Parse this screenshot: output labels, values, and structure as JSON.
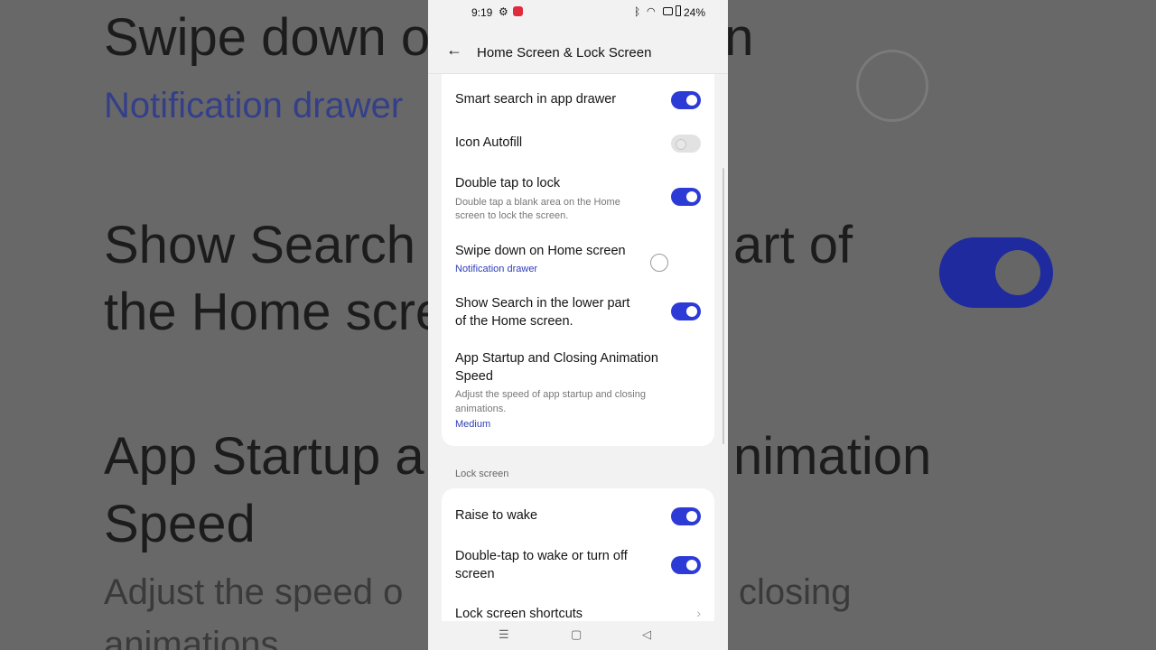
{
  "background": {
    "line1": "Swipe down o",
    "line1b": "en",
    "line2": "Notification drawer",
    "line3": "Show Search i",
    "line3b": "art of",
    "line4": "the Home scre",
    "line5": "App Startup a",
    "line5b": "nimation",
    "line6": "Speed",
    "line7": "Adjust the speed o",
    "line7b": "closing",
    "line8": "animations"
  },
  "status_bar": {
    "time": "9:19",
    "battery": "24%",
    "icons": [
      "gear-icon",
      "app-notification-icon",
      "bluetooth-icon",
      "wifi-icon",
      "sim-icon",
      "battery-icon"
    ]
  },
  "header": {
    "title": "Home Screen & Lock Screen",
    "back_icon": "arrow-left-icon"
  },
  "home_settings": [
    {
      "label": "Smart search in app drawer",
      "state": "on"
    },
    {
      "label": "Icon Autofill",
      "state": "off"
    },
    {
      "label": "Double tap to lock",
      "description": "Double tap a blank area on the Home screen to lock the screen.",
      "state": "on"
    },
    {
      "label": "Swipe down on Home screen",
      "value": "Notification drawer",
      "control": "radio"
    },
    {
      "label": "Show Search in the lower part of the Home screen.",
      "state": "on"
    },
    {
      "label": "App Startup and Closing Animation Speed",
      "description": "Adjust the speed of app startup and closing animations.",
      "value": "Medium"
    }
  ],
  "lock_screen": {
    "section_title": "Lock screen",
    "items": [
      {
        "label": "Raise to wake",
        "state": "on"
      },
      {
        "label": "Double-tap to wake or turn off screen",
        "state": "on"
      },
      {
        "label": "Lock screen shortcuts",
        "control": "chevron"
      }
    ]
  },
  "nav_bar": {
    "icons": [
      "menu-icon",
      "home-icon",
      "back-triangle-icon"
    ]
  },
  "colors": {
    "accent": "#2c3bd6",
    "link": "#2e3db8",
    "card_bg": "#ffffff",
    "screen_bg": "#f2f2f2"
  }
}
